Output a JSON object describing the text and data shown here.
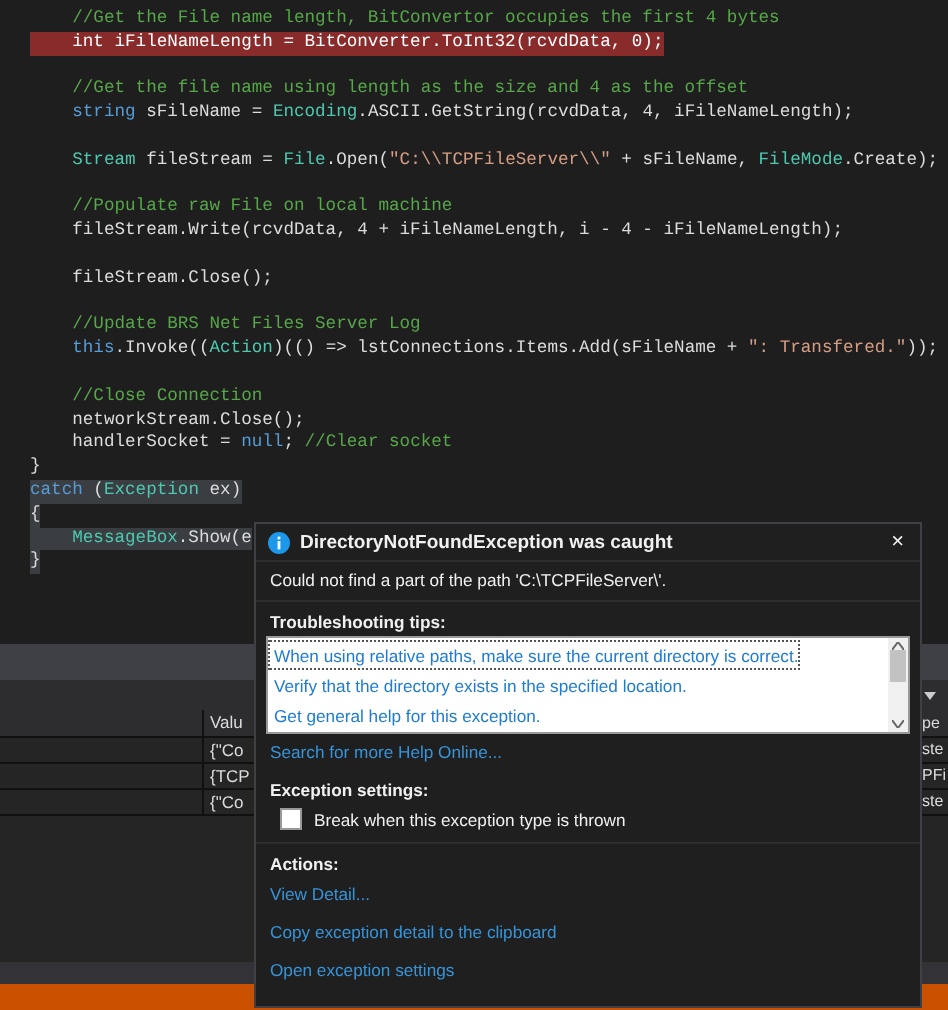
{
  "editor": {
    "lines": [
      {
        "kind": "code",
        "tokens": [
          {
            "kind": "comment",
            "text": "    //Get the File name length, BitConvertor occupies the first 4 bytes"
          }
        ]
      },
      {
        "kind": "error",
        "tokens": [
          {
            "kind": "plain",
            "text": "    int iFileNameLength = BitConverter.ToInt32(rcvdData, 0);"
          }
        ]
      },
      {
        "kind": "blank"
      },
      {
        "kind": "code",
        "tokens": [
          {
            "kind": "comment",
            "text": "    //Get the file name using length as the size and 4 as the offset"
          }
        ]
      },
      {
        "kind": "code",
        "tokens": [
          {
            "kind": "keyword",
            "text": "    string"
          },
          {
            "kind": "plain",
            "text": " sFileName = "
          },
          {
            "kind": "type",
            "text": "Encoding"
          },
          {
            "kind": "plain",
            "text": ".ASCII.GetString(rcvdData, 4, iFileNameLength);"
          }
        ]
      },
      {
        "kind": "blank"
      },
      {
        "kind": "code",
        "tokens": [
          {
            "kind": "type",
            "text": "    Stream"
          },
          {
            "kind": "plain",
            "text": " fileStream = "
          },
          {
            "kind": "type",
            "text": "File"
          },
          {
            "kind": "plain",
            "text": ".Open("
          },
          {
            "kind": "string",
            "text": "\"C:\\\\TCPFileServer\\\\\""
          },
          {
            "kind": "plain",
            "text": " + sFileName, "
          },
          {
            "kind": "type",
            "text": "FileMode"
          },
          {
            "kind": "plain",
            "text": ".Create);"
          }
        ]
      },
      {
        "kind": "blank"
      },
      {
        "kind": "code",
        "tokens": [
          {
            "kind": "comment",
            "text": "    //Populate raw File on local machine"
          }
        ]
      },
      {
        "kind": "code",
        "tokens": [
          {
            "kind": "plain",
            "text": "    fileStream.Write(rcvdData, 4 + iFileNameLength, i - 4 - iFileNameLength);"
          }
        ]
      },
      {
        "kind": "blank"
      },
      {
        "kind": "code",
        "tokens": [
          {
            "kind": "plain",
            "text": "    fileStream.Close();"
          }
        ]
      },
      {
        "kind": "blank"
      },
      {
        "kind": "code",
        "tokens": [
          {
            "kind": "comment",
            "text": "    //Update BRS Net Files Server Log"
          }
        ]
      },
      {
        "kind": "code",
        "tokens": [
          {
            "kind": "keyword",
            "text": "    this"
          },
          {
            "kind": "plain",
            "text": ".Invoke(("
          },
          {
            "kind": "type",
            "text": "Action"
          },
          {
            "kind": "plain",
            "text": ")(() => lstConnections.Items.Add(sFileName + "
          },
          {
            "kind": "string",
            "text": "\": Transfered.\""
          },
          {
            "kind": "plain",
            "text": "));"
          }
        ]
      },
      {
        "kind": "blank"
      },
      {
        "kind": "code",
        "tokens": [
          {
            "kind": "comment",
            "text": "    //Close Connection"
          }
        ]
      },
      {
        "kind": "code",
        "tokens": [
          {
            "kind": "plain",
            "text": "    networkStream.Close();"
          }
        ]
      },
      {
        "kind": "code",
        "tokens": [
          {
            "kind": "plain",
            "text": "    handlerSocket = "
          },
          {
            "kind": "keyword",
            "text": "null"
          },
          {
            "kind": "plain",
            "text": "; "
          },
          {
            "kind": "comment",
            "text": "//Clear socket"
          }
        ]
      },
      {
        "kind": "code",
        "tokens": [
          {
            "kind": "plain",
            "text": "}"
          }
        ]
      },
      {
        "kind": "selected",
        "tokens": [
          {
            "kind": "keyword",
            "text": "catch"
          },
          {
            "kind": "plain",
            "text": " ("
          },
          {
            "kind": "type",
            "text": "Exception"
          },
          {
            "kind": "plain",
            "text": " ex)"
          }
        ]
      },
      {
        "kind": "selected",
        "tokens": [
          {
            "kind": "plain",
            "text": "{"
          }
        ]
      },
      {
        "kind": "selected",
        "tokens": [
          {
            "kind": "type",
            "text": "    MessageBox"
          },
          {
            "kind": "plain",
            "text": ".Show(e"
          }
        ]
      },
      {
        "kind": "selected",
        "tokens": [
          {
            "kind": "plain",
            "text": "}"
          }
        ]
      }
    ]
  },
  "watch_panel": {
    "columns": [
      "Valu",
      "pe"
    ],
    "rows": [
      {
        "value": "{\"Co",
        "type": "ste"
      },
      {
        "value": "{TCP",
        "type": "PFi"
      },
      {
        "value": "{\"Co",
        "type": "ste"
      }
    ]
  },
  "exception_popup": {
    "title": "DirectoryNotFoundException was caught",
    "close": "×",
    "message": "Could not find a part of the path 'C:\\TCPFileServer\\'.",
    "tips_heading": "Troubleshooting tips:",
    "tips": [
      {
        "label": "When using relative paths, make sure the current directory is correct.",
        "selected": true
      },
      {
        "label": "Verify that the directory exists in the specified location.",
        "selected": false
      },
      {
        "label": "Get general help for this exception.",
        "selected": false
      }
    ],
    "search_link": "Search for more Help Online...",
    "settings_heading": "Exception settings:",
    "break_option": {
      "label": "Break when this exception type is thrown",
      "checked": false
    },
    "actions_heading": "Actions:",
    "actions": [
      "View Detail...",
      "Copy exception detail to the clipboard",
      "Open exception settings"
    ]
  }
}
